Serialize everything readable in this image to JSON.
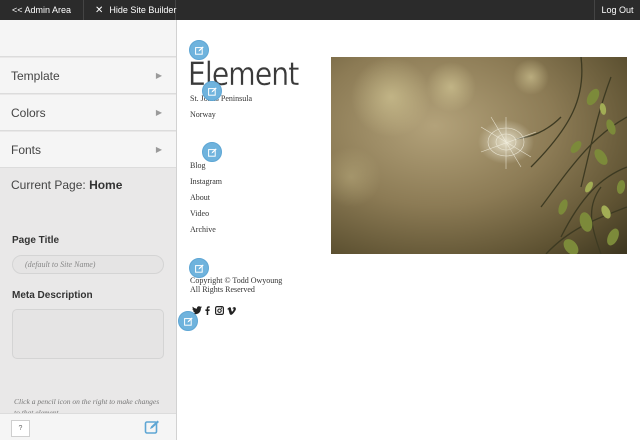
{
  "topbar": {
    "admin_area": "<< Admin Area",
    "hide_site_builder": "Hide Site Builder",
    "log_out": "Log Out"
  },
  "sidebar": {
    "menu": [
      {
        "label": "Template"
      },
      {
        "label": "Colors"
      },
      {
        "label": "Fonts"
      }
    ],
    "current_page_label": "Current Page:",
    "current_page_value": "Home",
    "page_title_label": "Page Title",
    "page_title_placeholder": "(default to Site Name)",
    "meta_description_label": "Meta Description",
    "hint": "Click a pencil icon on the right to make changes to that element",
    "help": "?"
  },
  "site": {
    "title": "Element",
    "location_line1": "St. Johns Peninsula",
    "location_line2": "Norway",
    "nav": [
      "Blog",
      "Instagram",
      "About",
      "Video",
      "Archive"
    ],
    "copyright": "Copyright © Todd Owyoung",
    "rights": "All Rights Reserved",
    "social_icons": [
      "twitter-icon",
      "facebook-icon",
      "instagram-icon",
      "vimeo-icon"
    ]
  },
  "colors": {
    "topbar": "#2b2b2b",
    "sidebar": "#e9e8e8",
    "pencil": "#6fb3dd"
  }
}
